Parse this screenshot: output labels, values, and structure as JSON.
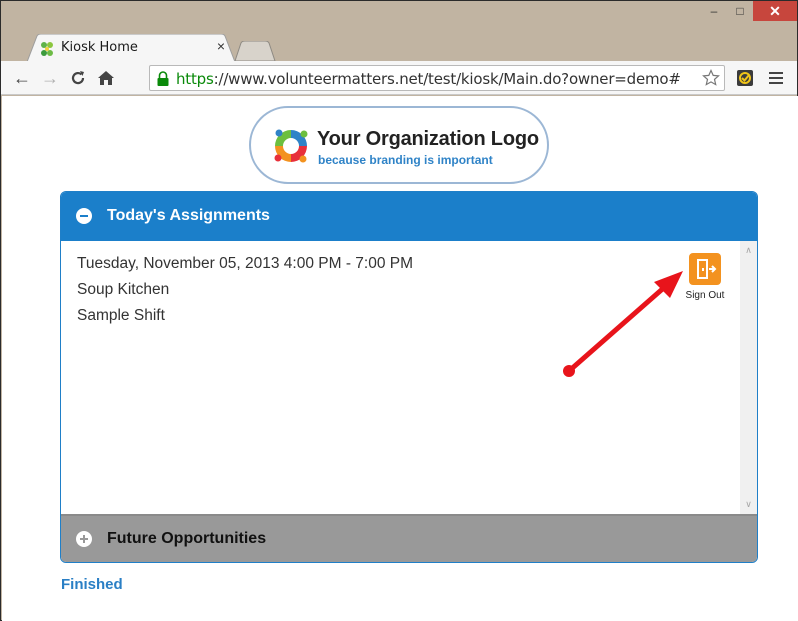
{
  "browser": {
    "tab_title": "Kiosk Home",
    "tab_close": "×",
    "url_scheme": "https",
    "url_rest": "://www.volunteermatters.net/test/kiosk/Main.do?owner=demo#"
  },
  "logo": {
    "title": "Your Organization Logo",
    "subtitle": "because branding is important"
  },
  "assignments": {
    "header": "Today's Assignments",
    "date_time": "Tuesday, November 05, 2013 4:00 PM - 7:00 PM",
    "location": "Soup Kitchen",
    "shift": "Sample Shift",
    "sign_out_label": "Sign Out"
  },
  "future": {
    "header": "Future Opportunities"
  },
  "finished_link": "Finished",
  "colors": {
    "header_blue": "#1b7fca",
    "sign_out_orange": "#f3921f",
    "footer_gray": "#999999",
    "annotation_red": "#e8141b"
  }
}
